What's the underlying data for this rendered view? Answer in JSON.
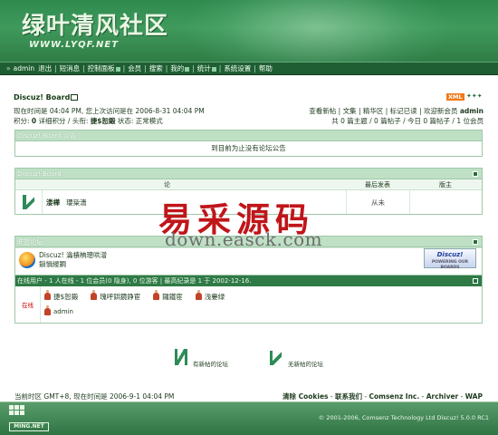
{
  "site": {
    "title": "绿叶清风社区",
    "url": "WWW.LYQF.NET"
  },
  "nav": {
    "items": [
      "admin",
      "退出",
      "短消息",
      "控制面板",
      "会员",
      "搜索",
      "我的",
      "统计",
      "系统设置",
      "帮助"
    ]
  },
  "breadcrumb": "Discuz! Board",
  "xml_badge": "XML",
  "userinfo": {
    "line1": "现在时间是 04:04 PM, 您上次访问是在 2006-8-31 04:04 PM",
    "line2_prefix": "积分: ",
    "credits": "0",
    "line2_mid": " 详细积分 / 头衔: ",
    "title": "捷$恕鍛",
    "line2_suffix": " 状态: 正常模式"
  },
  "quicklinks": {
    "links": [
      "查看新帖",
      "文集",
      "精华区",
      "标记已读",
      "欢迎新会员"
    ],
    "new_member": "admin",
    "stats": "共 0 篇主题 / 0 篇帖子 / 今日 0 篇帖子 / 1 位会员"
  },
  "announcement": {
    "header": "Discuz! Board 公告",
    "body": "到目前为止没有论坛公告"
  },
  "forum": {
    "header": "Discuz! Board",
    "columns": {
      "name": "论",
      "last_post": "最后发表",
      "moderator": "版主"
    },
    "rows": [
      {
        "name": "溇樺",
        "desc": "瓔粊濇",
        "last_post": "从未",
        "moderator": ""
      }
    ]
  },
  "links": {
    "header": "联盟论坛",
    "title": "Discuz! 瀹樻柟璁哄潧",
    "subtitle": "鎻愪緵鐧",
    "badge": "Discuz!",
    "badge_sub": "POWERING OUR BOARDS"
  },
  "online": {
    "header": "在线用户 - 1 人在线 - 1 位会员(0 隐身), 0 位游客 | 最高纪录是 1 于 2002-12-16.",
    "label": "在线",
    "users": [
      "捷$恕鍛",
      "瑰呼鉷鏡錚宦",
      "鑼鐵宦",
      "浅嫑绿"
    ],
    "self": "admin"
  },
  "legend": {
    "new": "有新帖的论坛",
    "old": "无新帖的论坛"
  },
  "bottom": {
    "left": "当前时区 GMT+8, 现在时间是 2006-9-1 04:04 PM",
    "links": [
      "清除 Cookies",
      "联系我们",
      "Comsenz Inc.",
      "Archiver",
      "WAP"
    ]
  },
  "footer": {
    "logo": "MING.NET",
    "copyright": "© 2001-2006, Comsenz Technology Ltd Discuz! 5.0.0 RC1"
  },
  "watermark": {
    "text": "易采源码",
    "url": "down.easck.com"
  },
  "colors": {
    "header_green": "#2f8a4e",
    "nav_dark": "#1f5e33",
    "box_border": "#9fc8a8",
    "xml_orange": "#f07a1a"
  }
}
